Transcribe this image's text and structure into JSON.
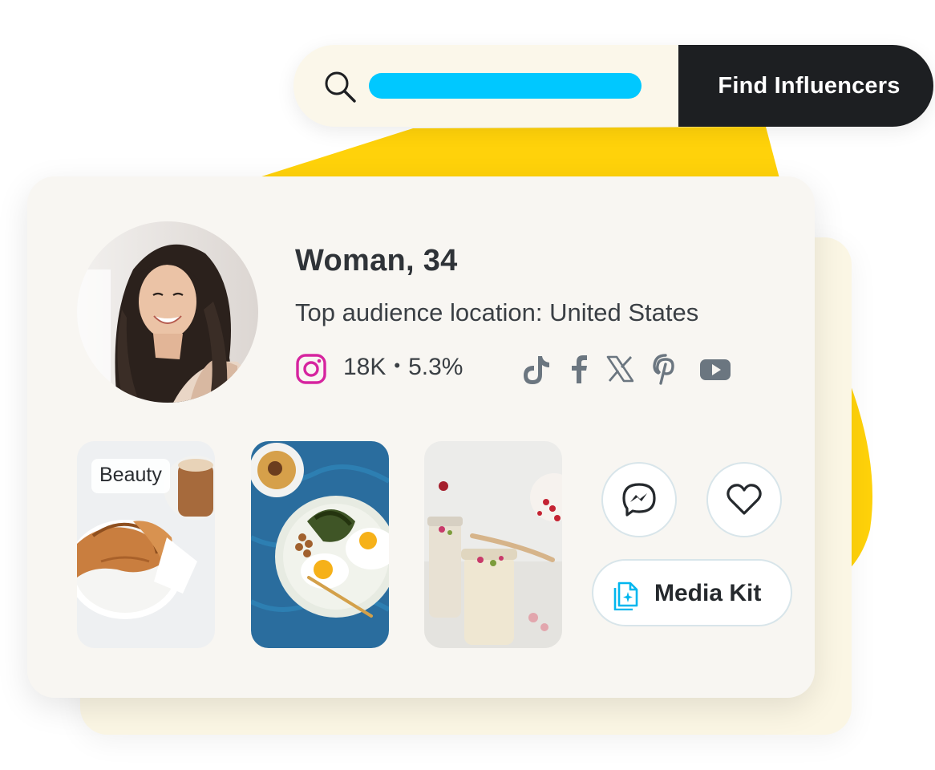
{
  "search": {
    "icon": "search-icon",
    "field_color": "#00c8ff",
    "button_label": "Find Influencers"
  },
  "profile": {
    "title": "Woman, 34",
    "audience_location": "Top audience location: United States",
    "avatar": "avatar-photo"
  },
  "instagram": {
    "icon": "instagram-icon",
    "followers": "18K",
    "separator": "•",
    "engagement": "5.3%"
  },
  "social_icons": [
    "tiktok-icon",
    "facebook-icon",
    "x-icon",
    "pinterest-icon",
    "youtube-icon"
  ],
  "content_tiles": [
    {
      "tag": "Beauty",
      "image": "croissant-coffee-photo"
    },
    {
      "image": "eggs-breakfast-photo"
    },
    {
      "image": "yogurt-jars-photo"
    }
  ],
  "actions": {
    "message_icon": "messenger-icon",
    "favorite_icon": "heart-icon",
    "media_kit_label": "Media Kit",
    "media_kit_icon": "media-kit-icon"
  },
  "colors": {
    "accent_yellow": "#ffd20a",
    "accent_cyan": "#00c8ff",
    "dark_button": "#1d1f22",
    "instagram_pink": "#d6249f",
    "card_background": "#f8f6f2",
    "icon_gray": "#6b7680"
  }
}
